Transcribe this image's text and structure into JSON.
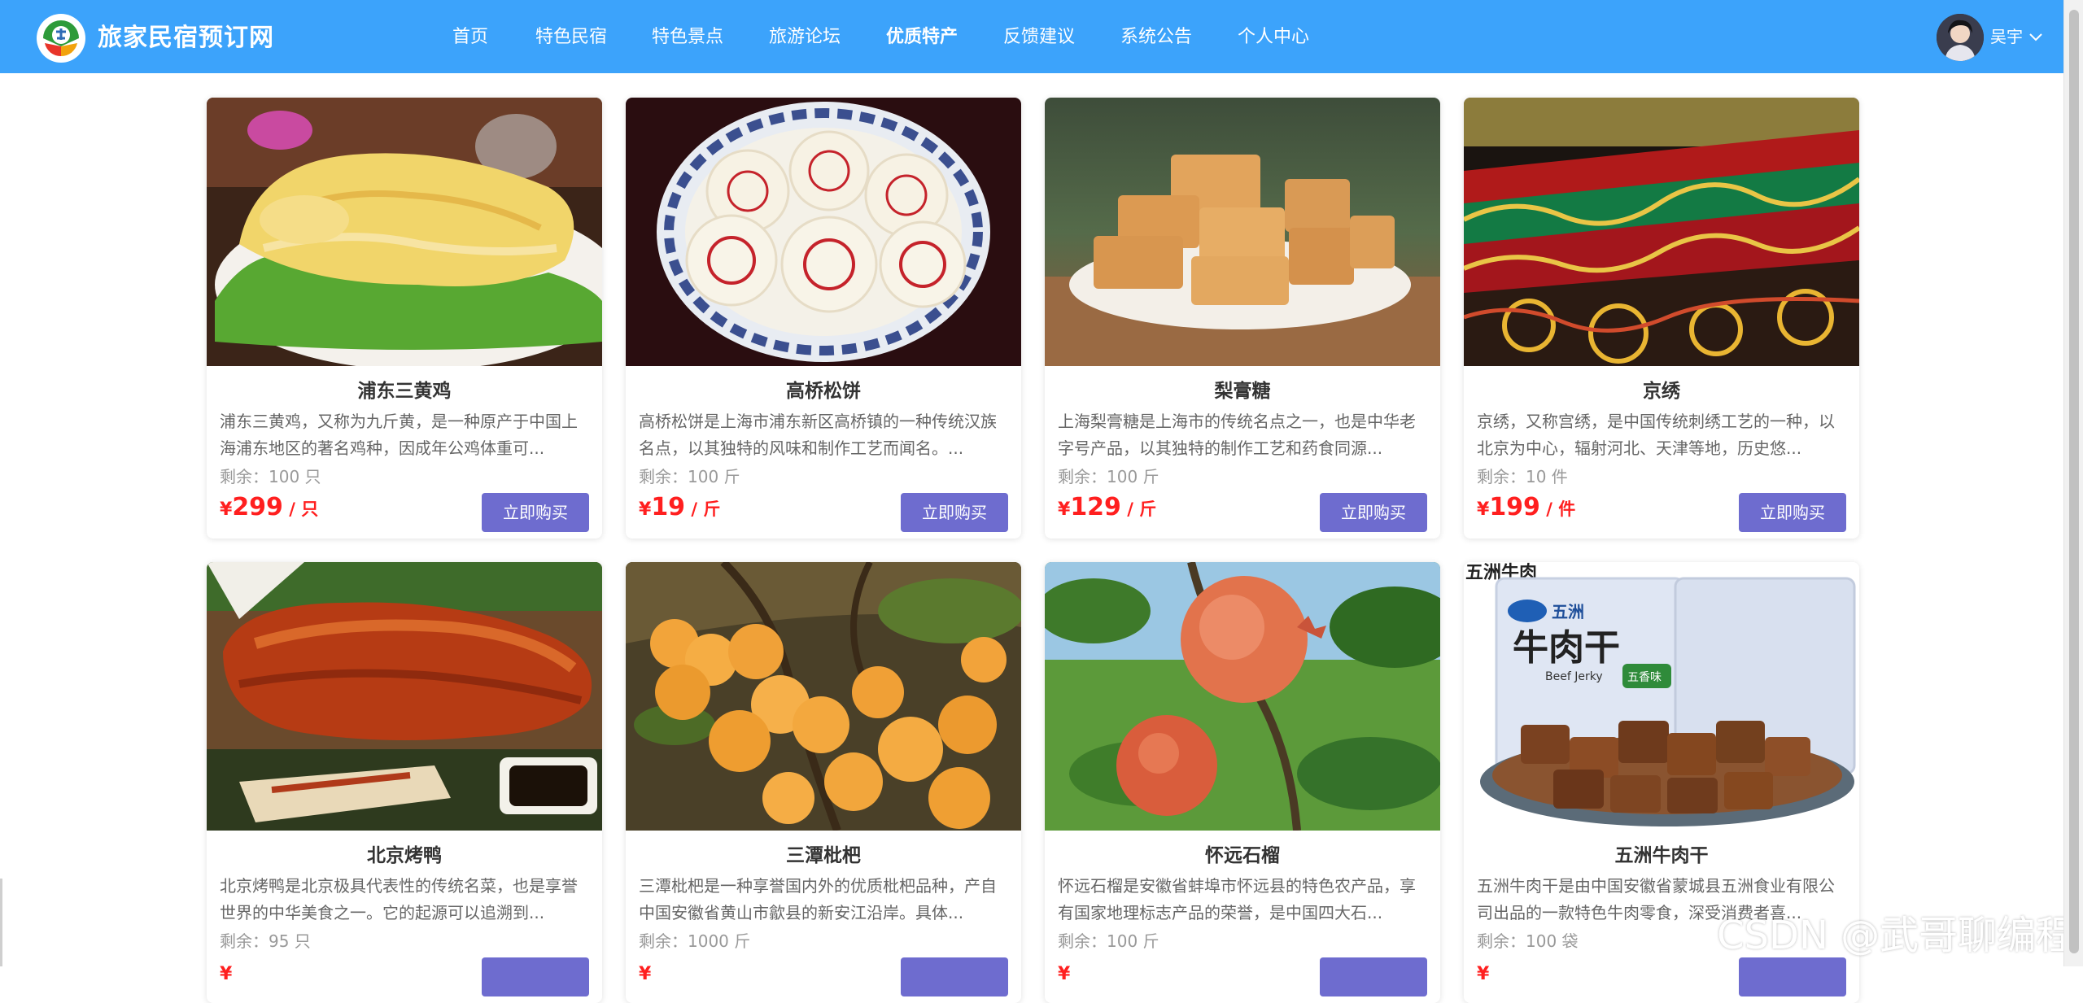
{
  "site": {
    "title": "旅家民宿预订网"
  },
  "nav": [
    {
      "label": "首页"
    },
    {
      "label": "特色民宿"
    },
    {
      "label": "特色景点"
    },
    {
      "label": "旅游论坛"
    },
    {
      "label": "优质特产",
      "active": true
    },
    {
      "label": "反馈建议"
    },
    {
      "label": "系统公告"
    },
    {
      "label": "个人中心"
    }
  ],
  "user": {
    "name": "吴宇",
    "avatar_icon": "user-avatar"
  },
  "colors": {
    "header": "#3ca3fb",
    "button": "#6e6ccf",
    "price": "#ff1f1f"
  },
  "products": [
    {
      "name": "浦东三黄鸡",
      "desc": "浦东三黄鸡，又称为九斤黄，是一种原产于中国上海浦东地区的著名鸡种，因成年公鸡体重可...",
      "stock": "剩余：100 只",
      "price_symbol": "¥",
      "price": "299",
      "unit": " / 只",
      "buy_label": "立即购买"
    },
    {
      "name": "高桥松饼",
      "desc": "高桥松饼是上海市浦东新区高桥镇的一种传统汉族名点，以其独特的风味和制作工艺而闻名。...",
      "stock": "剩余：100 斤",
      "price_symbol": "¥",
      "price": "19",
      "unit": " / 斤",
      "buy_label": "立即购买"
    },
    {
      "name": "梨膏糖",
      "desc": "上海梨膏糖是上海市的传统名点之一，也是中华老字号产品，以其独特的制作工艺和药食同源...",
      "stock": "剩余：100 斤",
      "price_symbol": "¥",
      "price": "129",
      "unit": " / 斤",
      "buy_label": "立即购买"
    },
    {
      "name": "京绣",
      "desc": "京绣，又称宫绣，是中国传统刺绣工艺的一种，以北京为中心，辐射河北、天津等地，历史悠...",
      "stock": "剩余：10 件",
      "price_symbol": "¥",
      "price": "199",
      "unit": " / 件",
      "buy_label": "立即购买"
    },
    {
      "name": "北京烤鸭",
      "desc": "北京烤鸭是北京极具代表性的传统名菜，也是享誉世界的中华美食之一。它的起源可以追溯到...",
      "stock": "剩余：95 只",
      "price_symbol": "¥",
      "price": "",
      "unit": "",
      "buy_label": ""
    },
    {
      "name": "三潭枇杷",
      "desc": "三潭枇杷是一种享誉国内外的优质枇杷品种，产自中国安徽省黄山市歙县的新安江沿岸。具体...",
      "stock": "剩余：1000 斤",
      "price_symbol": "¥",
      "price": "",
      "unit": "",
      "buy_label": ""
    },
    {
      "name": "怀远石榴",
      "desc": "怀远石榴是安徽省蚌埠市怀远县的特色农产品，享有国家地理标志产品的荣誉，是中国四大石...",
      "stock": "剩余：100 斤",
      "price_symbol": "¥",
      "price": "",
      "unit": "",
      "buy_label": ""
    },
    {
      "name": "五洲牛肉干",
      "desc": "五洲牛肉干是由中国安徽省蒙城县五洲食业有限公司出品的一款特色牛肉零食，深受消费者喜...",
      "stock": "剩余：100 袋",
      "price_symbol": "¥",
      "price": "",
      "unit": "",
      "buy_label": "",
      "package_text": [
        "五洲牛肉",
        "五洲",
        "牛肉干",
        "Beef Jerky",
        "五香味"
      ]
    }
  ],
  "watermark": "CSDN @武哥聊编程"
}
